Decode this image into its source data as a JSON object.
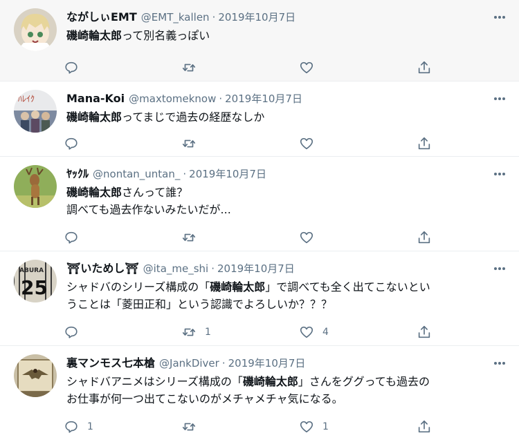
{
  "tweets": [
    {
      "name": "ながしぃEMT",
      "handle": "@EMT_kallen",
      "sep": "·",
      "date": "2019年10月7日",
      "lines": [
        {
          "bold": "磯崎輪太郎",
          "after": "って別名義っぽい"
        }
      ],
      "reply": "",
      "retweet": "",
      "like": "",
      "avatar_icon": "anime-girl-avatar"
    },
    {
      "name": "Mana-Koi",
      "handle": "@maxtomeknow",
      "sep": "·",
      "date": "2019年10月7日",
      "lines": [
        {
          "bold": "磯崎輪太郎",
          "after": "ってまじで過去の経歴なしか"
        }
      ],
      "reply": "",
      "retweet": "",
      "like": "",
      "avatar_icon": "poster-avatar"
    },
    {
      "name": "ﾔｯｸﾙ",
      "handle": "@nontan_untan_",
      "sep": "·",
      "date": "2019年10月7日",
      "lines": [
        {
          "bold": "磯崎輪太郎",
          "after": "さんって誰？"
        },
        {
          "before": "調べても過去作ないみたいだが..."
        }
      ],
      "reply": "",
      "retweet": "",
      "like": "",
      "avatar_icon": "deer-avatar"
    },
    {
      "name": "⛩いためし⛩",
      "handle": "@ita_me_shi",
      "sep": "·",
      "date": "2019年10月7日",
      "lines": [
        {
          "before": "シャドバのシリーズ構成の「",
          "bold": "磯崎輪太郎",
          "after": "」で調べても全く出てこないとい"
        },
        {
          "before": "うことは「菱田正和」という認識でよろしいか？？？"
        }
      ],
      "reply": "",
      "retweet": "1",
      "like": "4",
      "avatar_icon": "jersey-25-avatar"
    },
    {
      "name": "裏マンモス七本槍",
      "handle": "@JankDiver",
      "sep": "·",
      "date": "2019年10月7日",
      "lines": [
        {
          "before": "シャドバアニメはシリーズ構成の「",
          "bold": "磯崎輪太郎",
          "after": "」さんをググっても過去の"
        },
        {
          "before": "お仕事が何一つ出てこないのがメチャメチャ気になる。"
        }
      ],
      "reply": "1",
      "retweet": "",
      "like": "1",
      "avatar_icon": "eagle-avatar"
    }
  ],
  "colors": {
    "secondary_text": "#5b7083",
    "divider": "#ebeef0",
    "hover_bg": "#f7f7f7"
  }
}
